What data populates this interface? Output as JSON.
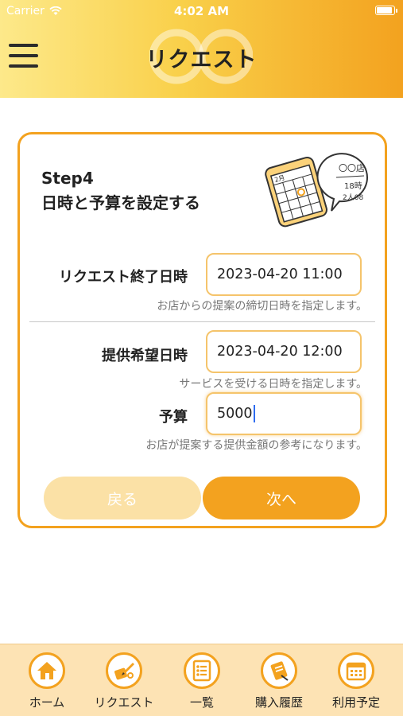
{
  "status_bar": {
    "carrier": "Carrier",
    "time": "4:02 AM"
  },
  "header": {
    "title": "リクエスト"
  },
  "card": {
    "step_title": "Step4",
    "step_subtitle": "日時と予算を設定する",
    "illustration_note": [
      "〇〇店",
      "18時",
      "2人08"
    ],
    "illustration_date": "2月",
    "fields": [
      {
        "label": "リクエスト終了日時",
        "value": "2023-04-20 11:00",
        "hint": "お店からの提案の締切日時を指定します。"
      },
      {
        "label": "提供希望日時",
        "value": "2023-04-20 12:00",
        "hint": "サービスを受ける日時を指定します。"
      },
      {
        "label": "予算",
        "value": "5000",
        "hint": "お店が提案する提供金額の参考になります。"
      }
    ],
    "back_label": "戻る",
    "next_label": "次へ"
  },
  "tabbar": {
    "items": [
      {
        "label": "ホーム",
        "icon": "home-icon"
      },
      {
        "label": "リクエスト",
        "icon": "request-icon"
      },
      {
        "label": "一覧",
        "icon": "list-icon"
      },
      {
        "label": "購入履歴",
        "icon": "purchase-history-icon"
      },
      {
        "label": "利用予定",
        "icon": "calendar-icon"
      }
    ]
  },
  "colors": {
    "accent": "#f3a21f",
    "accent_light": "#fbe1a6",
    "tabbar_bg": "#fde3b4",
    "caret": "#2e6cf0"
  }
}
